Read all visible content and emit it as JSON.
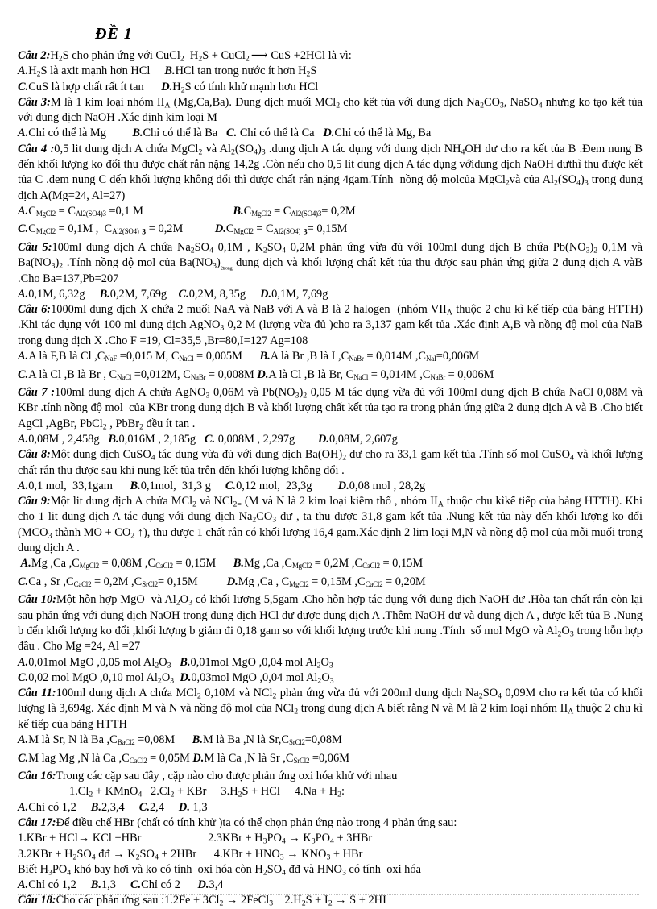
{
  "document": {
    "title": "ĐỀ 1",
    "language": "vi",
    "questions": [
      {
        "id": "cau-2",
        "label": "Câu 2:",
        "stem": "H<sub>2</sub>S cho phản ứng với CuCl<sub>2</sub>&nbsp;&nbsp;H<sub>2</sub>S + CuCl<sub>2</sub><span class=\"arrow-long\">⟶</span> CuS +2HCl là vì:",
        "options_lines": [
          "<span class=\"opt\">A.</span>H<sub>2</sub>S là axit mạnh hơn HCl&nbsp;&nbsp;&nbsp;&nbsp;&nbsp;<span class=\"opt\">B.</span>HCl tan trong nước ít hơn H<sub>2</sub>S",
          "<span class=\"opt\">C.</span>CuS là hợp chất rất ít tan&nbsp;&nbsp;&nbsp;&nbsp;&nbsp;&nbsp;<span class=\"opt\">D.</span>H<sub>2</sub>S có tính khử mạnh hơn HCl"
        ]
      },
      {
        "id": "cau-3",
        "label": "Câu 3:",
        "stem": "M là 1 kim loại nhóm II<sub>A</sub> (Mg,Ca,Ba). Dung dịch muối MCl<sub>2</sub> cho kết tủa với dung dịch Na<sub>2</sub>CO<sub>3</sub>, NaSO<sub>4</sub> nhưng ko tạo kết tủa với dung dịch NaOH .Xác định kim loại M",
        "options_lines": [
          "<span class=\"opt\">A.</span>Chỉ có thể là Mg&nbsp;&nbsp;&nbsp;&nbsp;&nbsp;&nbsp;&nbsp;&nbsp;&nbsp;<span class=\"opt\">B.</span>Chỉ có thể là Ba&nbsp;&nbsp;&nbsp;<span class=\"opt\">C.</span> Chỉ có thể là Ca&nbsp;&nbsp;&nbsp;<span class=\"opt\">D.</span>Chỉ có thể là Mg, Ba"
        ]
      },
      {
        "id": "cau-4",
        "label": "Câu 4 :",
        "stem": "0,5 lit dung dịch A chứa MgCl<sub>2</sub> và Al<sub>2</sub>(SO<sub>4</sub>)<sub>3</sub> .dung dịch A tác dụng với dung dịch NH<sub>4</sub>OH dư cho ra kết tủa B .Đem nung B đến khối lượng ko đổi thu được chất rắn nặng 14,2g .Còn nếu cho 0,5 lit dung dịch A tác dụng vớidung dịch NaOH dưthì thu được kết tủa C .đem nung C đến khối lượng không đổi thì được chất rắn nặng 4gam.Tính&nbsp; nồng độ molcủa MgCl<sub>2</sub>và của Al<sub>2</sub>(SO<sub>4</sub>)<sub>3</sub> trong dung dịch A(Mg=24, Al=27)",
        "options_lines": [
          "<span class=\"opt\">A.</span>C<span class=\"smallsub\">MgCl2</span> = C<span class=\"smallsub\">Al2(SO4)3</span> =0,1 M&nbsp;&nbsp;&nbsp;&nbsp;&nbsp;&nbsp;&nbsp;&nbsp;&nbsp;&nbsp;&nbsp;&nbsp;&nbsp;&nbsp;&nbsp;&nbsp;&nbsp;&nbsp;&nbsp;&nbsp;&nbsp;&nbsp;&nbsp;&nbsp;&nbsp;&nbsp;&nbsp;&nbsp;&nbsp;&nbsp;&nbsp;<span class=\"opt\">B.</span>C<span class=\"smallsub\">MgCl2</span> = C<span class=\"smallsub\">Al2(SO4)3</span>= 0,2M",
          "<span class=\"opt\">C.</span>C<span class=\"smallsub\">MgCl2</span> = 0,1M ,&nbsp; C<span class=\"smallsub\">Al2(SO4)</span> <sub><b>3</b></sub> = 0,2M&nbsp;&nbsp;&nbsp;&nbsp;&nbsp;&nbsp;&nbsp;&nbsp;&nbsp;&nbsp;&nbsp;<span class=\"opt\">D.</span>C<span class=\"smallsub\">MgCl2</span> = C<span class=\"smallsub\">Al2(SO4)</span> <sub><b>3</b></sub>= 0,15M"
        ]
      },
      {
        "id": "cau-5",
        "label": "Câu 5:",
        "stem": "100ml dung dịch A chứa Na<sub>2</sub>SO<sub>4</sub> 0,1M , K<sub>2</sub>SO<sub>4</sub> 0,2M phản ứng vừa đủ với 100ml dung dịch B chứa Pb(NO<sub>3</sub>)<sub>2</sub> 0,1M và Ba(NO<sub>3</sub>)<sub>2</sub> .Tính nồng độ mol của Ba(NO<sub>3</sub>)<sub><span class=\"smallsub\">2trong</span></sub> dung dịch và khối lượng chất kết tủa thu được sau phản ứng giữa 2 dung dịch A vàB .Cho Ba=137,Pb=207",
        "options_lines": [
          "<span class=\"opt\">A.</span>0,1M, 6,32g&nbsp;&nbsp;&nbsp;&nbsp;&nbsp;<span class=\"opt\">B.</span>0,2M, 7,69g&nbsp;&nbsp;&nbsp;&nbsp;<span class=\"opt\">C.</span>0,2M, 8,35g&nbsp;&nbsp;&nbsp;&nbsp;&nbsp;<span class=\"opt\">D.</span>0,1M, 7,69g"
        ]
      },
      {
        "id": "cau-6",
        "label": "Câu 6:",
        "stem": "1000ml dung dịch X chứa 2 muối NaA và NaB với A và B là 2 halogen&nbsp; (nhóm VII<sub>A</sub> thuộc 2 chu kì kế tiếp của bảng HTTH) .Khi tác dụng với 100 ml dung dịch AgNO<sub>3</sub> 0,2 M (lượng vừa đủ )cho ra 3,137 gam kết tủa .Xác định A,B và nồng độ mol của NaB trong dung dịch X .Cho F =19, Cl=35,5 ,Br=80,I=127 Ag=108",
        "options_lines": [
          "<span class=\"opt\">A.</span>A là F,B là Cl ,C<span class=\"smallsub\">NaF</span> =0,015 M, C<span class=\"smallsub\">NaCl</span> = 0,005M&nbsp;&nbsp;&nbsp;&nbsp;&nbsp;&nbsp;<span class=\"opt\">B.</span>A là Br ,B là I ,C<span class=\"smallsub\">NaBr</span> = 0,014M ,C<span class=\"smallsub\">NaI</span>=0,006M",
          "<span class=\"opt\">C.</span>A là Cl ,B là Br , C<span class=\"smallsub\">NaCl</span> =0,012M, C<span class=\"smallsub\">NaBr</span> = 0,008M <span class=\"opt\">D.</span>A là Cl ,B là Br, C<span class=\"smallsub\">NaCl</span> = 0,014M ,C<span class=\"smallsub\">NaBr</span> = 0,006M"
        ]
      },
      {
        "id": "cau-7",
        "label": "Câu 7 :",
        "stem": "100ml dung dịch A chứa AgNO<sub>3</sub> 0,06M và Pb(NO<sub>3</sub>)<sub>2</sub> 0,05 M tác dụng vừa đủ với 100ml dung dịch B chứa NaCl 0,08M và KBr .tính nồng độ mol&nbsp; của KBr trong dung dịch B và khối lượng chất kết tủa tạo ra trong phản ứng giữa 2 dung dịch A và B .Cho biết AgCl ,AgBr, PbCl<sub>2</sub> , PbBr<sub>2</sub> đều ít tan .",
        "options_lines": [
          "<span class=\"opt\">A.</span>0,08M , 2,458g&nbsp;&nbsp;&nbsp;<span class=\"opt\">B.</span>0,016M , 2,185g&nbsp;&nbsp;&nbsp;<span class=\"opt\">C.</span> 0,008M , 2,297g&nbsp;&nbsp;&nbsp;&nbsp;&nbsp;&nbsp;&nbsp;&nbsp;<span class=\"opt\">D.</span>0,08M, 2,607g"
        ]
      },
      {
        "id": "cau-8",
        "label": "Câu 8:",
        "stem": "Một dung dịch CuSO<sub>4</sub> tác dụng vừa đủ với dung dịch Ba(OH)<sub>2</sub> dư cho ra 33,1 gam kết tủa .Tính số mol CuSO<sub>4</sub> và khối lượng chất rắn thu được sau khi nung kết tủa trên đến khối lượng không đổi .",
        "options_lines": [
          "<span class=\"opt\">A.</span>0,1 mol,&nbsp; 33,1gam&nbsp;&nbsp;&nbsp;&nbsp;&nbsp;&nbsp;<span class=\"opt\">B.</span>0,1mol,&nbsp; 31,3 g&nbsp;&nbsp;&nbsp;&nbsp;&nbsp;<span class=\"opt\">C.</span>0,12 mol,&nbsp; 23,3g&nbsp;&nbsp;&nbsp;&nbsp;&nbsp;&nbsp;&nbsp;&nbsp;&nbsp;<span class=\"opt\">D.</span>0,08 mol , 28,2g"
        ]
      },
      {
        "id": "cau-9",
        "label": "Câu 9:",
        "stem": "Một lit dung dịch A chứa MCl<sub>2</sub> và NCl<sub>2=</sub> (M và N là 2 kim loại kiềm thổ , nhóm II<sub>A</sub> thuộc chu kìkế tiếp của bảng HTTH). Khi cho 1 lit dung dịch A tác dụng với dung dịch Na<sub>2</sub>CO<sub>3</sub> dư , ta thu được 31,8 gam kết tủa .Nung kết tủa này đến khối lượng ko đổi (MCO<sub>3</sub> thành MO + CO<sub>2</sub> ↑), thu được 1 chất rắn có khối lượng 16,4 gam.Xác định 2 lim loại M,N và nồng độ mol của mỗi muối trong dung dịch A .",
        "options_lines": [
          "&nbsp;<span class=\"opt\">A.</span>Mg ,Ca ,C<span class=\"smallsub\">MgCl2</span> = 0,08M ,C<span class=\"smallsub\">CaCl2</span> = 0,15M&nbsp;&nbsp;&nbsp;&nbsp;&nbsp;&nbsp;<span class=\"opt\">B.</span>Mg ,Ca ,C<span class=\"smallsub\">MgCl2</span> = 0,2M ,C<span class=\"smallsub\">CaCl2</span> = 0,15M",
          "<span class=\"opt\">C.</span>Ca , Sr ,C<span class=\"smallsub\">CaCl2</span> = 0,2M ,C<span class=\"smallsub\">SrCl2</span>= 0,15M&nbsp;&nbsp;&nbsp;&nbsp;&nbsp;&nbsp;&nbsp;&nbsp;&nbsp;&nbsp;<span class=\"opt\">D.</span>Mg ,Ca , C<span class=\"smallsub\">MgCl2</span> = 0,15M ,C<span class=\"smallsub\">CaCl2</span> = 0,20M"
        ]
      },
      {
        "id": "cau-10",
        "label": "Câu 10:",
        "stem": "Một hỗn hợp MgO&nbsp; và Al<sub>2</sub>O<sub>3</sub> có khối lượng 5,5gam .Cho hỗn hợp tác dụng với dung dịch NaOH dư .Hòa tan chất rắn còn lại sau phản ứng với dung dịch NaOH trong dung dịch HCl dư được dung dịch A .Thêm NaOH dư và dung dịch A , được kết tủa B .Nung b đến khối lượng ko đổi ,khối lượng b giảm đi 0,18 gam so với khối lượng trước khi nung .Tính&nbsp; số mol MgO và Al<sub>2</sub>O<sub>3</sub> trong hỗn hợp đầu . Cho Mg =24, Al =27",
        "options_lines": [
          "<span class=\"opt\">A.</span>0,01mol MgO ,0,05 mol Al<sub>2</sub>O<sub>3</sub>&nbsp;&nbsp;&nbsp;<span class=\"opt\">B.</span>0,01mol MgO ,0,04 mol Al<sub>2</sub>O<sub>3</sub>",
          "<span class=\"opt\">C.</span>0,02 mol MgO ,0,10 mol Al<sub>2</sub>O<sub>3</sub>&nbsp;&nbsp;<span class=\"opt\">D.</span>0,03mol MgO ,0,04 mol Al<sub>2</sub>O<sub>3</sub>"
        ]
      },
      {
        "id": "cau-11",
        "label": "Câu 11:",
        "stem": "100ml dung dịch A chứa MCl<sub>2</sub> 0,10M và NCl<sub>2</sub> phản ứng vừa đủ với 200ml dung dịch Na<sub>2</sub>SO<sub>4</sub> 0,09M cho ra kết tủa có khối lượng là 3,694g. Xác định M và N và nồng độ mol của NCl<sub>2</sub> trong dung dịch A biết rằng N và M là 2 kim loại nhóm II<sub>A</sub> thuộc 2 chu kì kế tiếp của bảng HTTH",
        "options_lines": [
          "<span class=\"opt\">A.</span>M là Sr, N là Ba ,C<span class=\"smallsub\">BaCl2</span> =0,08M&nbsp;&nbsp;&nbsp;&nbsp;&nbsp;&nbsp;<span class=\"opt\">B.</span>M là Ba ,N là Sr,C<span class=\"smallsub\">SrCl2</span>=0,08M",
          "<span class=\"opt\">C.</span>M lag Mg ,N là Ca ,C<span class=\"smallsub\">CaCl2</span> = 0,05M <span class=\"opt\">D.</span>M là Ca ,N là Sr ,C<span class=\"smallsub\">SrCl2</span> =0,06M"
        ]
      },
      {
        "id": "cau-16",
        "label": "Câu 16:",
        "stem": "Trong các cặp sau đây , cặp nào cho được phản ứng oxi hóa khử với nhau",
        "sub_items": "1.Cl<sub>2</sub> + KMnO<sub>4</sub>&nbsp;&nbsp;&nbsp;2.Cl<sub>2</sub> + KBr&nbsp;&nbsp;&nbsp;&nbsp;&nbsp;3.H<sub>2</sub>S + HCl&nbsp;&nbsp;&nbsp;&nbsp;&nbsp;4.Na + H<sub>2</sub>:",
        "options_lines": [
          "<span class=\"opt\">A.</span>Chỉ có 1,2&nbsp;&nbsp;&nbsp;&nbsp;&nbsp;<span class=\"opt\">B.</span>2,3,4&nbsp;&nbsp;&nbsp;&nbsp;&nbsp;<span class=\"opt\">C.</span>2,4&nbsp;&nbsp;&nbsp;&nbsp;&nbsp;<span class=\"opt\">D.</span> 1,3"
        ]
      },
      {
        "id": "cau-17",
        "label": "Câu 17:",
        "stem": "Để điều chế HBr (chất có tính khử )ta có thể chọn phản ứng nào trong 4 phản ứng sau:",
        "reactions": [
          "1.KBr + HCl→ KCl +HBr&nbsp;&nbsp;&nbsp;&nbsp;&nbsp;&nbsp;&nbsp;&nbsp;&nbsp;&nbsp;&nbsp;&nbsp;&nbsp;&nbsp;&nbsp;&nbsp;&nbsp;&nbsp;&nbsp;&nbsp;&nbsp;&nbsp;&nbsp;2.3KBr + H<sub>3</sub>PO<sub>4</sub> → K<sub>3</sub>PO<sub>4</sub> + 3HBr",
          "3.2KBr + H<sub>2</sub>SO<sub>4</sub> đđ → K<sub>2</sub>SO<sub>4</sub> + 2HBr&nbsp;&nbsp;&nbsp;&nbsp;&nbsp;&nbsp;4.KBr + HNO<sub>3</sub> → KNO<sub>3</sub> + HBr"
        ],
        "note": "Biết H<sub>3</sub>PO<sub>4</sub> khó bay hơi và ko có tính&nbsp; oxi hóa còn H<sub>2</sub>SO<sub>4</sub> đđ và HNO<sub>3</sub> có tính&nbsp; oxi hóa",
        "options_lines": [
          "<span class=\"opt\">A.</span>Chỉ có 1,2&nbsp;&nbsp;&nbsp;&nbsp;&nbsp;<span class=\"opt\">B.</span>1,3&nbsp;&nbsp;&nbsp;&nbsp;&nbsp;<span class=\"opt\">C.</span>Chỉ có 2&nbsp;&nbsp;&nbsp;&nbsp;&nbsp;&nbsp;<span class=\"opt\">D.</span>3,4"
        ]
      },
      {
        "id": "cau-18",
        "label": "Câu 18:",
        "stem": "Cho các phản ứng sau :1.2Fe + 3Cl<sub>2</sub> → 2FeCl<sub>3</sub>&nbsp;&nbsp;&nbsp;&nbsp;2.H<sub>2</sub>S + I<sub>2</sub> → S + 2HI"
      }
    ]
  }
}
